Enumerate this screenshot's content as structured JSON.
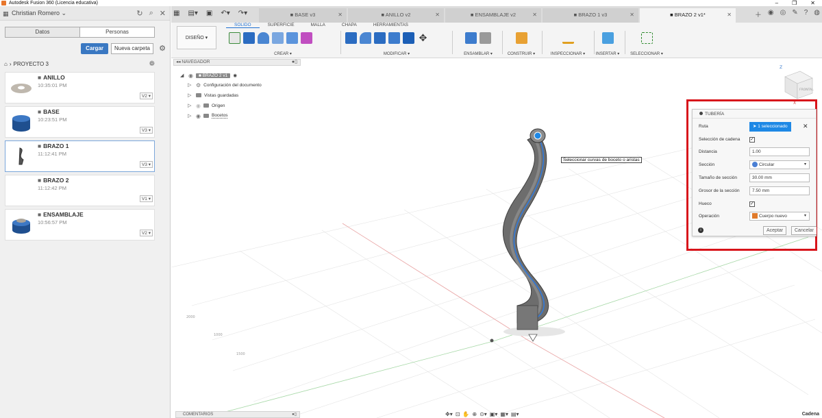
{
  "window": {
    "title": "Autodesk Fusion 360 (Licencia educativa)",
    "min": "–",
    "max": "❐",
    "close": "✕"
  },
  "data_panel": {
    "user": "Christian Romero",
    "tabs": [
      "Datos",
      "Personas"
    ],
    "upload_label": "Cargar",
    "new_folder_label": "Nueva carpeta",
    "breadcrumb": "PROYECTO 3",
    "files": [
      {
        "name": "ANILLO",
        "time": "10:35:01 PM",
        "version": "V2 ▾"
      },
      {
        "name": "BASE",
        "time": "10:23:51 PM",
        "version": "V3 ▾"
      },
      {
        "name": "BRAZO 1",
        "time": "11:12:41 PM",
        "version": "V3 ▾"
      },
      {
        "name": "BRAZO 2",
        "time": "11:12:42 PM",
        "version": "V1 ▾"
      },
      {
        "name": "ENSAMBLAJE",
        "time": "10:56:57 PM",
        "version": "V2 ▾"
      }
    ]
  },
  "doc_tabs": [
    "BASE v3",
    "ANILLO v2",
    "ENSAMBLAJE v2",
    "BRAZO 1 v3",
    "BRAZO 2 v1*"
  ],
  "ribbon": {
    "workspace": "DISEÑO ▾",
    "tabs": [
      "SOLIDO",
      "SUPERFICIE",
      "MALLA",
      "CHAPA",
      "HERRAMIENTAS"
    ],
    "groups": [
      "CREAR ▾",
      "MODIFICAR ▾",
      "ENSAMBLAR ▾",
      "CONSTRUIR ▾",
      "INSPECCIONAR ▾",
      "INSERTAR ▾",
      "SELECCIONAR ▾"
    ]
  },
  "browser": {
    "title": "NAVEGADOR",
    "root": "BRAZO 2 v1",
    "items": [
      "Configuración del documento",
      "Vistas guardadas",
      "Origen",
      "Bocetos"
    ]
  },
  "comments_label": "COMENTARIOS",
  "status_right": "Cadena",
  "tooltip": "Seleccionar curvas de boceto o aristas",
  "view_cube": {
    "top": "Z",
    "front": "FRONTAL",
    "axis_x": "X"
  },
  "pipe_dialog": {
    "title": "TUBERÍA",
    "ruta_label": "Ruta",
    "ruta_value": "1 seleccionado",
    "chain_label": "Selección de cadena",
    "distance_label": "Distancia",
    "distance_value": "1.00",
    "section_label": "Sección",
    "section_value": "Circular",
    "size_label": "Tamaño de sección",
    "size_value": "30.00 mm",
    "thickness_label": "Grosor de la sección",
    "thickness_value": "7.50 mm",
    "hollow_label": "Hueco",
    "operation_label": "Operación",
    "operation_value": "Cuerpo nuevo",
    "ok_label": "Aceptar",
    "cancel_label": "Cancelar"
  },
  "colors": {
    "accent": "#1e88e5",
    "highlight": "#d8141b",
    "upload": "#3a78c2"
  }
}
